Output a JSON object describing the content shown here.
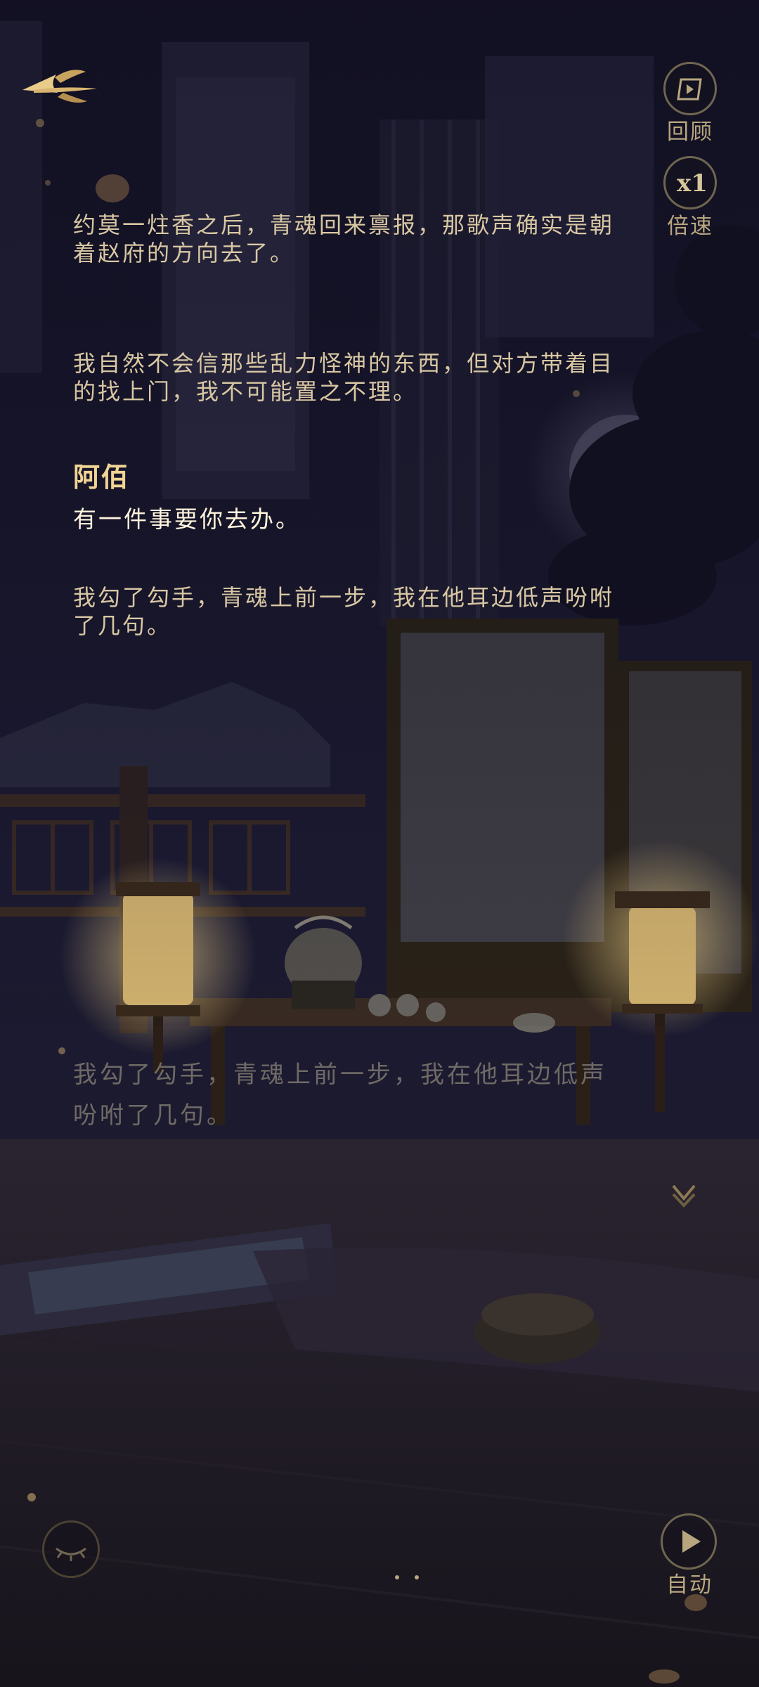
{
  "header": {
    "review_label": "回顾",
    "speed_value": "x1",
    "speed_label": "倍速"
  },
  "dialogue_log": {
    "entries": [
      {
        "type": "narration",
        "text_lines": [
          "约莫一炷香之后，青魂回来禀报，那歌声确实是朝",
          "着赵府的方向去了。"
        ]
      },
      {
        "type": "narration",
        "text_lines": [
          "我自然不会信那些乱力怪神的东西，但对方带着目",
          "的找上门，我不可能置之不理。"
        ]
      },
      {
        "type": "speech",
        "speaker": "阿佰",
        "text": "有一件事要你去办。"
      },
      {
        "type": "narration",
        "text_lines": [
          "我勾了勾手，青魂上前一步，我在他耳边低声吩咐",
          "了几句。"
        ]
      }
    ]
  },
  "current_line": {
    "text_lines": [
      "我勾了勾手，青魂上前一步，我在他耳边低声",
      "吩咐了几句。"
    ]
  },
  "footer": {
    "auto_label": "自动"
  },
  "colors": {
    "gold": "#f1d494",
    "narration": "#d8c7a3",
    "dim_text": "#6f6a66"
  }
}
